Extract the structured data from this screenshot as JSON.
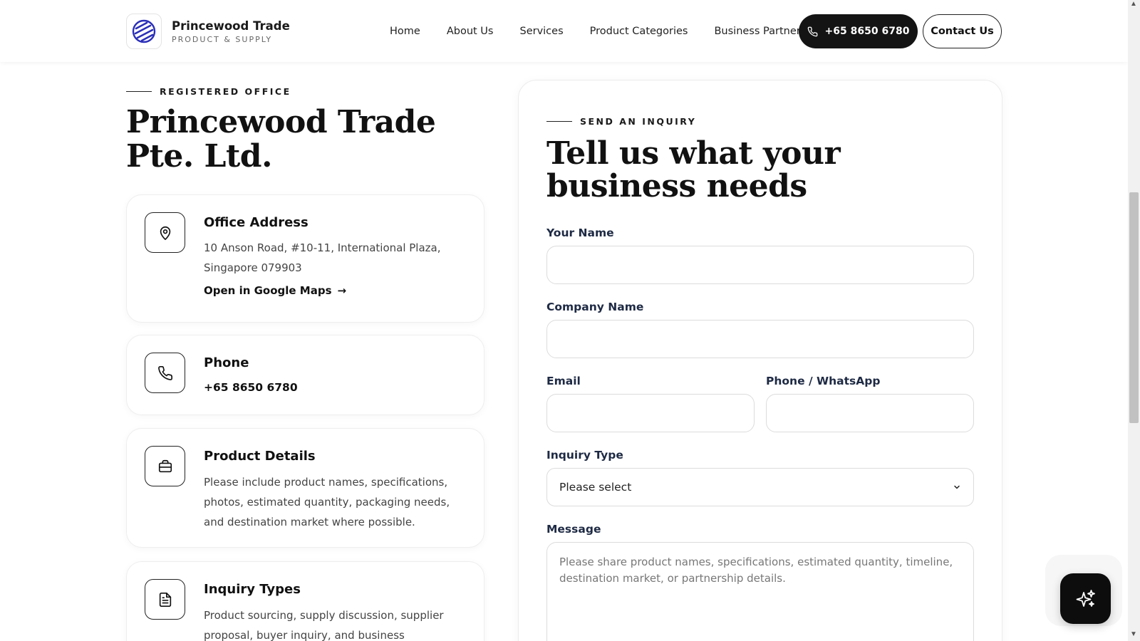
{
  "header": {
    "brand_name": "Princewood Trade",
    "brand_sub": "PRODUCT & SUPPLY",
    "nav": [
      "Home",
      "About Us",
      "Services",
      "Product Categories",
      "Business Partners"
    ],
    "phone_button": "+65 8650 6780",
    "contact_button": "Contact Us"
  },
  "office": {
    "eyebrow": "REGISTERED OFFICE",
    "title": "Princewood Trade Pte. Ltd.",
    "cards": {
      "address": {
        "icon": "map-pin-icon",
        "title": "Office Address",
        "text": "10 Anson Road, #10-11, International Plaza, Singapore 079903",
        "link": "Open in Google Maps"
      },
      "phone": {
        "icon": "phone-icon",
        "title": "Phone",
        "value": "+65 8650 6780"
      },
      "product": {
        "icon": "briefcase-icon",
        "title": "Product Details",
        "text": "Please include product names, specifications, photos, estimated quantity, packaging needs, and destination market where possible."
      },
      "inquiry": {
        "icon": "document-icon",
        "title": "Inquiry Types",
        "text": "Product sourcing, supply discussion, supplier proposal, buyer inquiry, and business partnership."
      }
    }
  },
  "form": {
    "eyebrow": "SEND AN INQUIRY",
    "title": "Tell us what your business needs",
    "fields": {
      "name_label": "Your Name",
      "name_value": "",
      "company_label": "Company Name",
      "company_value": "",
      "email_label": "Email",
      "email_value": "",
      "phone_label": "Phone / WhatsApp",
      "phone_value": "",
      "inquiry_label": "Inquiry Type",
      "inquiry_selected": "Please select",
      "message_label": "Message",
      "message_placeholder": "Please share product names, specifications, estimated quantity, timeline, destination market, or partnership details."
    }
  },
  "fab": {
    "icon": "sparkles-icon"
  },
  "colors": {
    "dark": "#141414",
    "label": "#1e2a44",
    "logo_accent": "#2b2fb8"
  }
}
